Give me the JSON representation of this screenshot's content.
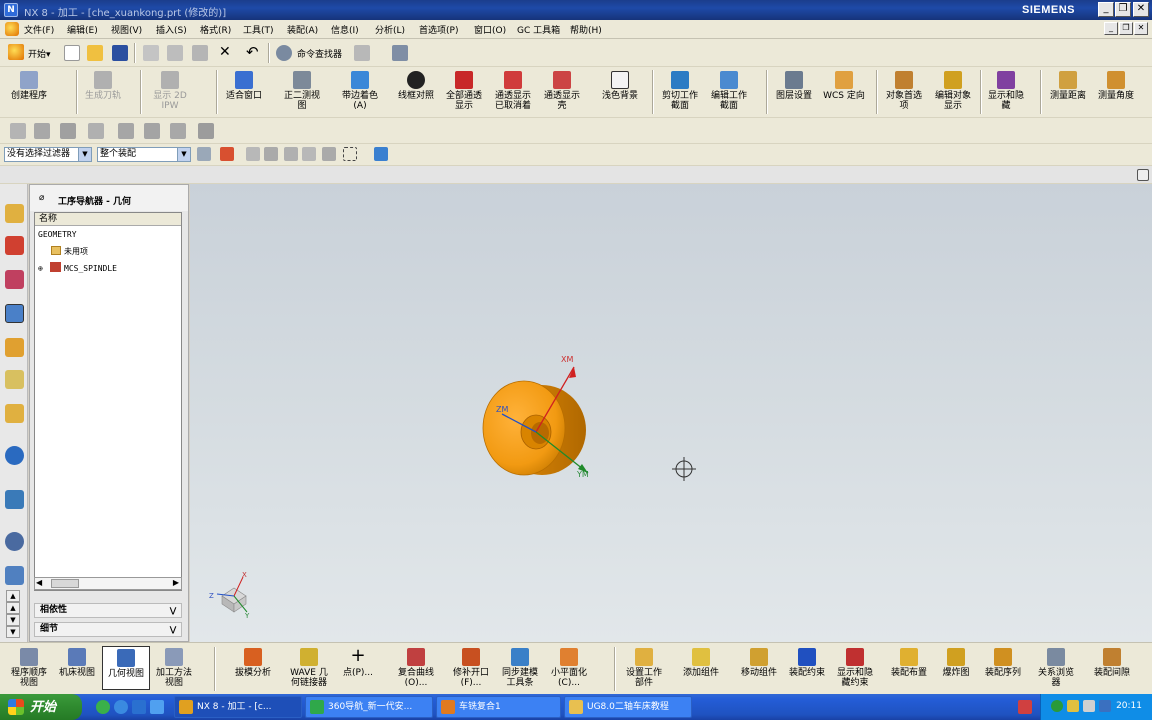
{
  "window": {
    "title": "NX 8 - 加工 - [che_xuankong.prt (修改的)]",
    "brand": "SIEMENS",
    "controls": [
      "_",
      "❐",
      "✕"
    ]
  },
  "menu": {
    "items": [
      "文件(F)",
      "编辑(E)",
      "视图(V)",
      "插入(S)",
      "格式(R)",
      "工具(T)",
      "装配(A)",
      "信息(I)",
      "分析(L)",
      "首选项(P)",
      "窗口(O)",
      "GC 工具箱",
      "帮助(H)"
    ]
  },
  "standard_toolbar": {
    "start_label": "开始▾",
    "command_finder_label": "命令查找器"
  },
  "main_toolbar": {
    "buttons": [
      {
        "label": "创建程序",
        "color": "#8fa3c9"
      },
      {
        "label": "生成刀轨",
        "color": "#b0b0b0"
      },
      {
        "label": "显示 2D IPW",
        "color": "#b0b0b0"
      },
      {
        "label": "适合窗口",
        "color": "#3a6fd1"
      },
      {
        "label": "正二测视图",
        "color": "#7d8a99"
      },
      {
        "label": "带边着色(A)",
        "color": "#3b88d8"
      },
      {
        "label": "线框对照",
        "color": "#222222"
      },
      {
        "label": "全部通透显示",
        "color": "#c82828"
      },
      {
        "label": "通透显示已取消着",
        "color": "#d03b3b"
      },
      {
        "label": "通透显示壳",
        "color": "#cc4444"
      },
      {
        "label": "浅色背景",
        "color": "#f4f4f4"
      },
      {
        "label": "剪切工作截面",
        "color": "#2b7bc4"
      },
      {
        "label": "编辑工作截面",
        "color": "#4a8ad0"
      },
      {
        "label": "图层设置",
        "color": "#6b7b8f"
      },
      {
        "label": "WCS 定向",
        "color": "#e0a040"
      },
      {
        "label": "对象首选项",
        "color": "#c08030"
      },
      {
        "label": "编辑对象显示",
        "color": "#d0a020"
      },
      {
        "label": "显示和隐藏",
        "color": "#8040a0"
      },
      {
        "label": "测量距离",
        "color": "#d0a040"
      },
      {
        "label": "测量角度",
        "color": "#d09030"
      }
    ]
  },
  "selection_bar": {
    "filter": "没有选择过滤器",
    "scope": "整个装配"
  },
  "navigator": {
    "title": "工序导航器 - 几何",
    "column": "名称",
    "rows": [
      "GEOMETRY",
      "未用项",
      "MCS_SPINDLE"
    ],
    "panels": [
      "相依性",
      "细节"
    ]
  },
  "graphics": {
    "axes": {
      "x": "XM",
      "y": "YM",
      "z": "ZM"
    },
    "triad": {
      "x": "X",
      "y": "Y",
      "z": "Z"
    }
  },
  "bottom_toolbar": {
    "buttons": [
      {
        "label": "程序顺序视图",
        "color": "#7a8aa8"
      },
      {
        "label": "机床视图",
        "color": "#5a7ab8"
      },
      {
        "label": "几何视图",
        "color": "#3a6ab8"
      },
      {
        "label": "加工方法视图",
        "color": "#8a9ab8"
      },
      {
        "label": "拔模分析",
        "color": "#d86020"
      },
      {
        "label": "WAVE 几何链接器",
        "color": "#d0b030"
      },
      {
        "label": "点(P)...",
        "color": "#333333"
      },
      {
        "label": "复合曲线(O)...",
        "color": "#c04040"
      },
      {
        "label": "修补开口(F)...",
        "color": "#c85020"
      },
      {
        "label": "同步建模工具条",
        "color": "#3a80c8"
      },
      {
        "label": "小平面化(C)...",
        "color": "#e08030"
      },
      {
        "label": "设置工作部件",
        "color": "#e0b040"
      },
      {
        "label": "添加组件",
        "color": "#e0c040"
      },
      {
        "label": "移动组件",
        "color": "#d0a030"
      },
      {
        "label": "装配约束",
        "color": "#2050c0"
      },
      {
        "label": "显示和隐藏约束",
        "color": "#c03030"
      },
      {
        "label": "装配布置",
        "color": "#e0b030"
      },
      {
        "label": "爆炸图",
        "color": "#d0a020"
      },
      {
        "label": "装配序列",
        "color": "#d09020"
      },
      {
        "label": "关系浏览器",
        "color": "#7a8aa0"
      },
      {
        "label": "装配间隙",
        "color": "#c08030"
      }
    ]
  },
  "taskbar": {
    "start": "开始",
    "tasks": [
      {
        "label": "NX 8 - 加工 - [c...",
        "color": "#e0a020"
      },
      {
        "label": "360导航_新一代安...",
        "color": "#2fa84a"
      },
      {
        "label": "车铣复合1",
        "color": "#e07a20"
      },
      {
        "label": "UG8.0二轴车床教程",
        "color": "#e8c050"
      }
    ],
    "clock": "20:11"
  }
}
